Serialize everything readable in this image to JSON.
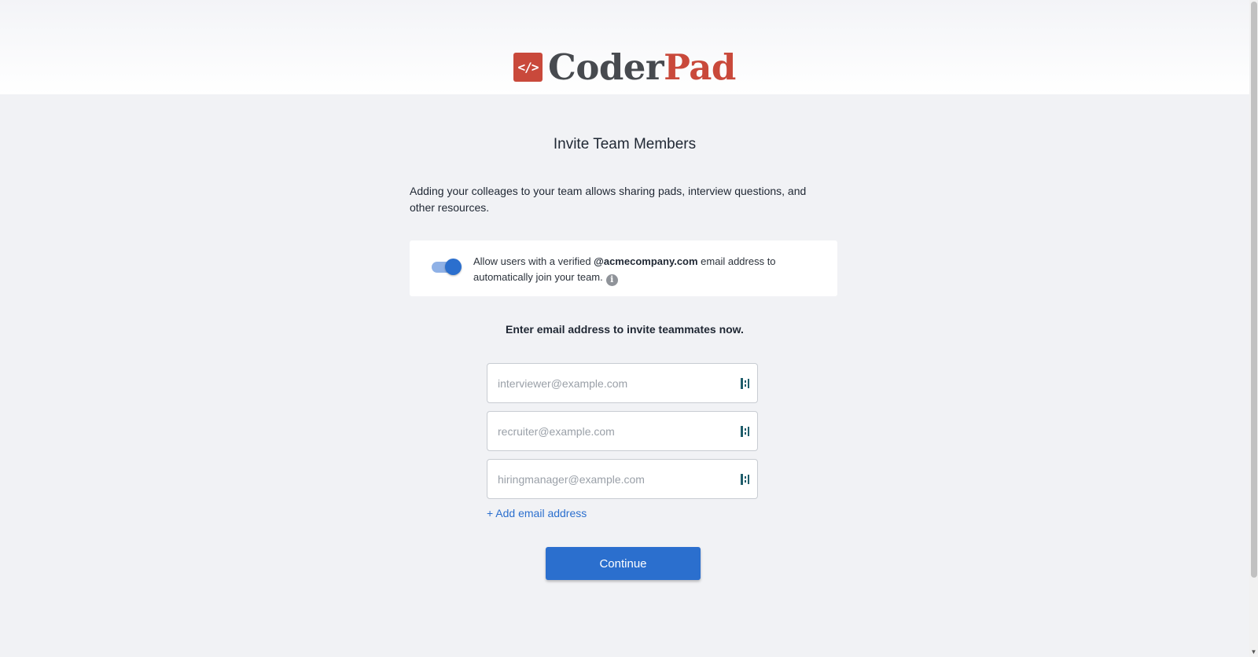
{
  "brand": {
    "logo_mark": "</>",
    "name_part1": "Coder",
    "name_part2": "Pad",
    "accent_color": "#c9493b"
  },
  "page": {
    "title": "Invite Team Members",
    "intro": "Adding your colleages to your team allows sharing pads, interview questions, and other resources."
  },
  "auto_join": {
    "enabled": true,
    "text_before": "Allow users with a verified ",
    "domain": "@acmecompany.com",
    "text_after": " email address to automatically join your team.",
    "info_icon": "info-icon"
  },
  "invite": {
    "label": "Enter email address to invite teammates now.",
    "fields": [
      {
        "placeholder": "interviewer@example.com",
        "value": ""
      },
      {
        "placeholder": "recruiter@example.com",
        "value": ""
      },
      {
        "placeholder": "hiringmanager@example.com",
        "value": ""
      }
    ],
    "add_label": "+ Add email address"
  },
  "actions": {
    "continue_label": "Continue",
    "primary_color": "#2b6fce"
  }
}
